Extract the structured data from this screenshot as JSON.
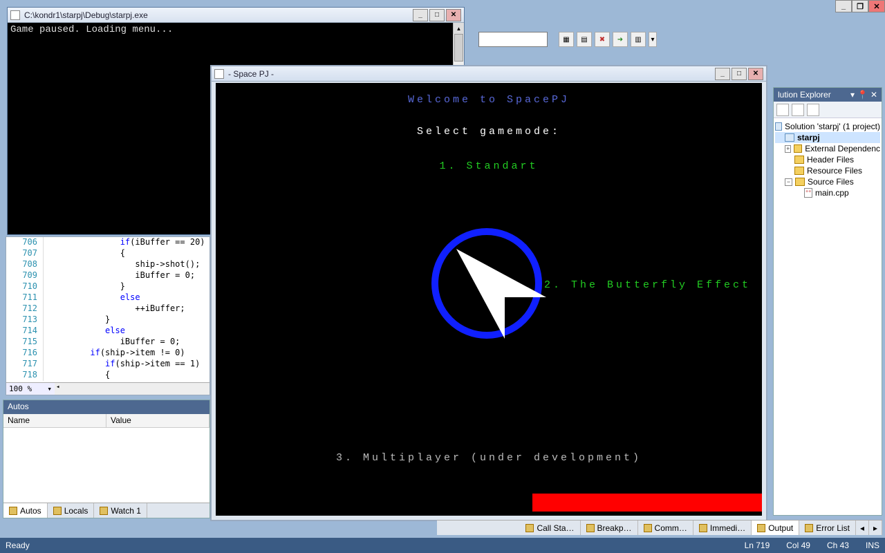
{
  "ide": {
    "toolbar_icons": [
      "a",
      "b",
      "c",
      "d",
      "e"
    ]
  },
  "console": {
    "title": "C:\\kondr1\\starpj\\Debug\\starpj.exe",
    "output": "Game paused. Loading menu..."
  },
  "code": {
    "zoom": "100 %",
    "lines": [
      {
        "n": "706",
        "text": "            if(iBuffer == 20)"
      },
      {
        "n": "707",
        "text": "            {"
      },
      {
        "n": "708",
        "text": "               ship->shot();"
      },
      {
        "n": "709",
        "text": "               iBuffer = 0;"
      },
      {
        "n": "710",
        "text": "            }"
      },
      {
        "n": "711",
        "text": "            else"
      },
      {
        "n": "712",
        "text": "               ++iBuffer;"
      },
      {
        "n": "713",
        "text": "         }"
      },
      {
        "n": "714",
        "text": "         else"
      },
      {
        "n": "715",
        "text": "            iBuffer = 0;"
      },
      {
        "n": "716",
        "text": "      if(ship->item != 0)"
      },
      {
        "n": "717",
        "text": "         if(ship->item == 1)"
      },
      {
        "n": "718",
        "text": "         {"
      }
    ]
  },
  "autos": {
    "title": "Autos",
    "col_name": "Name",
    "col_value": "Value",
    "tabs": {
      "autos": "Autos",
      "locals": "Locals",
      "watch1": "Watch 1"
    }
  },
  "bottom_tabs": {
    "call_stack": "Call Sta…",
    "breakpoints": "Breakp…",
    "command": "Comm…",
    "immediate": "Immedi…",
    "output": "Output",
    "error_list": "Error List"
  },
  "game": {
    "window_title": " - Space PJ - ",
    "welcome": "Welcome to SpacePJ",
    "select": "Select gamemode:",
    "opt1": "1. Standart",
    "opt2": "2. The Butterfly Effect",
    "opt3": "3. Multiplayer (under development)"
  },
  "solution": {
    "title": "lution Explorer",
    "root": "Solution 'starpj' (1 project)",
    "project": "starpj",
    "folders": {
      "ext": "External Dependenc",
      "headers": "Header Files",
      "resources": "Resource Files",
      "sources": "Source Files"
    },
    "file_main": "main.cpp"
  },
  "status": {
    "ready": "Ready",
    "ln": "Ln 719",
    "col": "Col 49",
    "ch": "Ch 43",
    "ins": "INS"
  }
}
